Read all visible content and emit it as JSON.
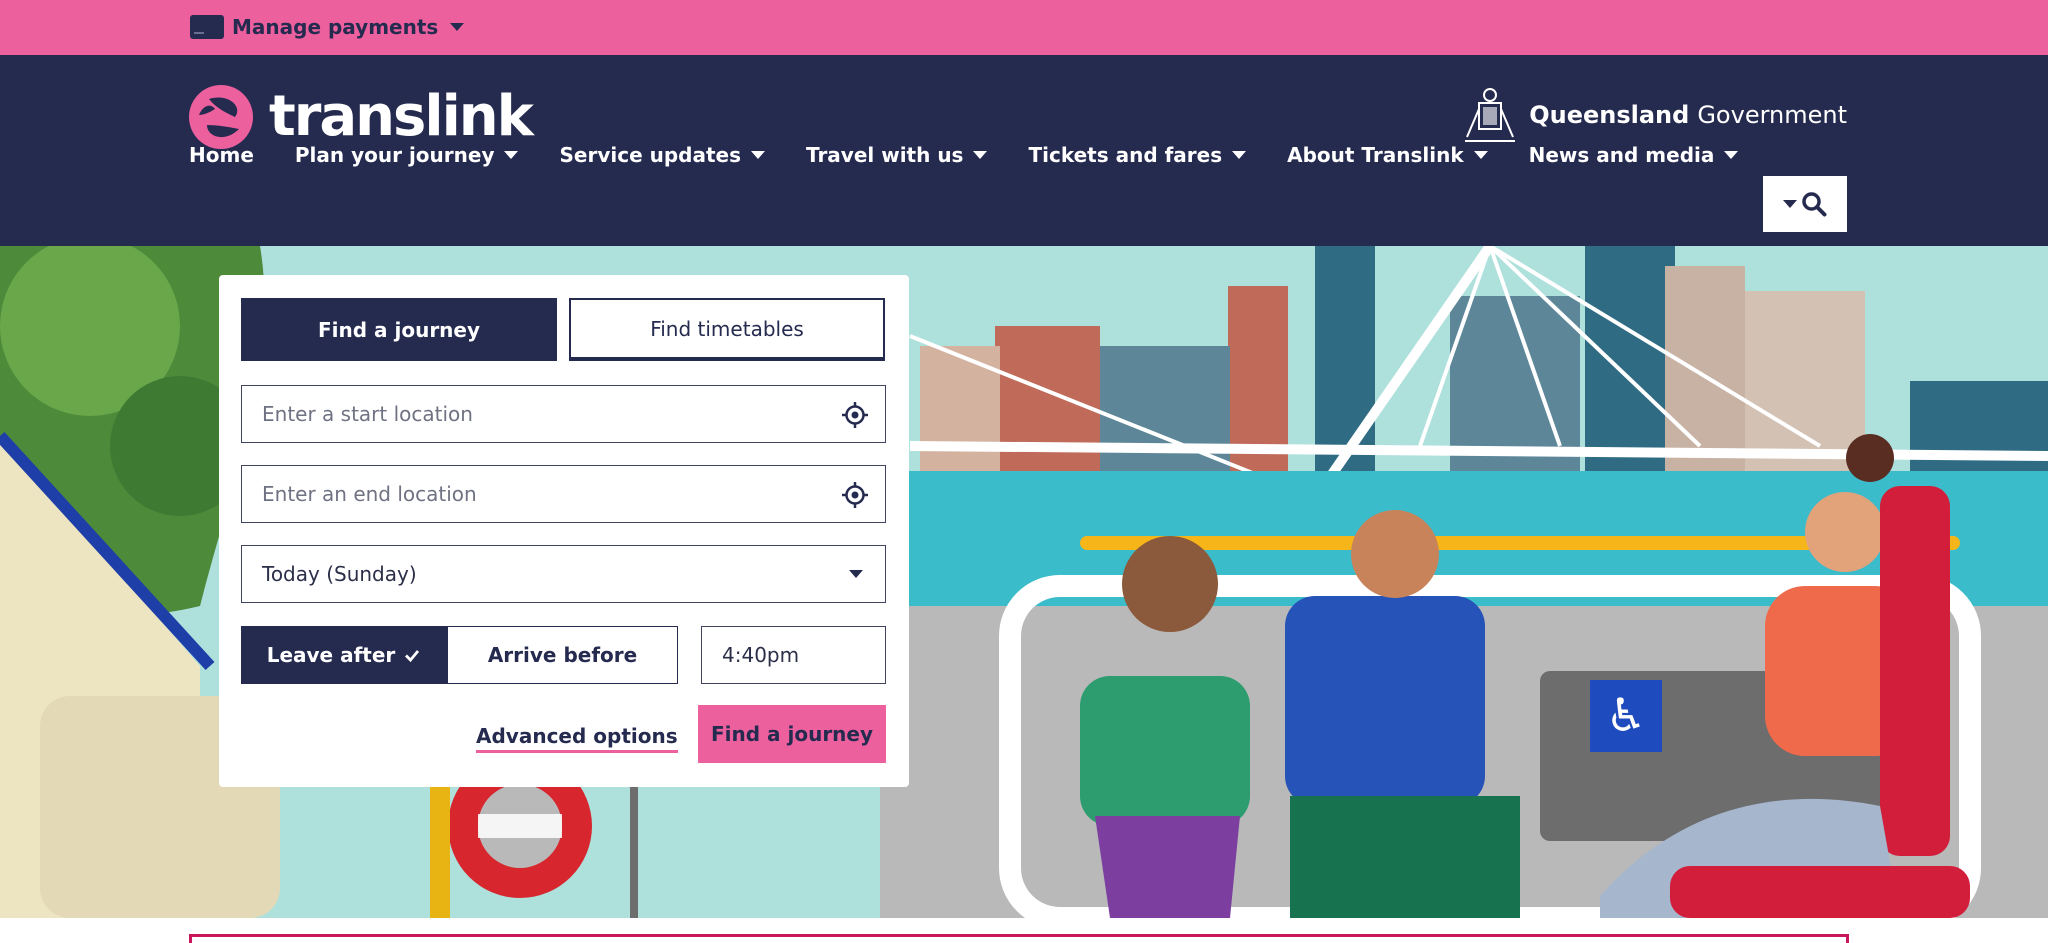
{
  "topbar": {
    "manage_label": "Manage payments"
  },
  "header": {
    "logo_text": "translink",
    "gov_bold": "Queensland",
    "gov_regular": "Government"
  },
  "nav": {
    "items": [
      {
        "label": "Home"
      },
      {
        "label": "Plan your journey"
      },
      {
        "label": "Service updates"
      },
      {
        "label": "Travel with us"
      },
      {
        "label": "Tickets and fares"
      },
      {
        "label": "About Translink"
      },
      {
        "label": "News and media"
      }
    ]
  },
  "planner": {
    "tabs": [
      "Find a journey",
      "Find timetables"
    ],
    "start_placeholder": "Enter a start location",
    "end_placeholder": "Enter an end location",
    "day_value": "Today (Sunday)",
    "leave_after": "Leave after",
    "arrive_before": "Arrive before",
    "time_value": "4:40pm",
    "advanced_label": "Advanced options",
    "submit_label": "Find a journey"
  },
  "colors": {
    "brand_pink": "#ec609e",
    "navy": "#252a4f",
    "accent_red": "#c8175a"
  },
  "icons": {
    "search": "search-icon",
    "locate": "crosshair-icon",
    "card": "payment-card-icon"
  }
}
